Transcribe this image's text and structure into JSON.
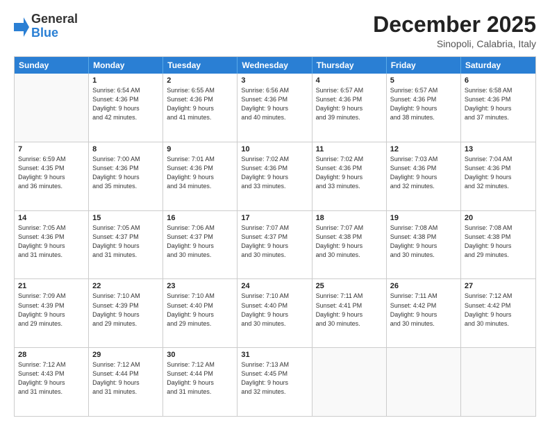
{
  "logo": {
    "general": "General",
    "blue": "Blue"
  },
  "header": {
    "month": "December 2025",
    "location": "Sinopoli, Calabria, Italy"
  },
  "days": [
    "Sunday",
    "Monday",
    "Tuesday",
    "Wednesday",
    "Thursday",
    "Friday",
    "Saturday"
  ],
  "rows": [
    [
      {
        "day": "",
        "lines": []
      },
      {
        "day": "1",
        "lines": [
          "Sunrise: 6:54 AM",
          "Sunset: 4:36 PM",
          "Daylight: 9 hours",
          "and 42 minutes."
        ]
      },
      {
        "day": "2",
        "lines": [
          "Sunrise: 6:55 AM",
          "Sunset: 4:36 PM",
          "Daylight: 9 hours",
          "and 41 minutes."
        ]
      },
      {
        "day": "3",
        "lines": [
          "Sunrise: 6:56 AM",
          "Sunset: 4:36 PM",
          "Daylight: 9 hours",
          "and 40 minutes."
        ]
      },
      {
        "day": "4",
        "lines": [
          "Sunrise: 6:57 AM",
          "Sunset: 4:36 PM",
          "Daylight: 9 hours",
          "and 39 minutes."
        ]
      },
      {
        "day": "5",
        "lines": [
          "Sunrise: 6:57 AM",
          "Sunset: 4:36 PM",
          "Daylight: 9 hours",
          "and 38 minutes."
        ]
      },
      {
        "day": "6",
        "lines": [
          "Sunrise: 6:58 AM",
          "Sunset: 4:36 PM",
          "Daylight: 9 hours",
          "and 37 minutes."
        ]
      }
    ],
    [
      {
        "day": "7",
        "lines": [
          "Sunrise: 6:59 AM",
          "Sunset: 4:35 PM",
          "Daylight: 9 hours",
          "and 36 minutes."
        ]
      },
      {
        "day": "8",
        "lines": [
          "Sunrise: 7:00 AM",
          "Sunset: 4:36 PM",
          "Daylight: 9 hours",
          "and 35 minutes."
        ]
      },
      {
        "day": "9",
        "lines": [
          "Sunrise: 7:01 AM",
          "Sunset: 4:36 PM",
          "Daylight: 9 hours",
          "and 34 minutes."
        ]
      },
      {
        "day": "10",
        "lines": [
          "Sunrise: 7:02 AM",
          "Sunset: 4:36 PM",
          "Daylight: 9 hours",
          "and 33 minutes."
        ]
      },
      {
        "day": "11",
        "lines": [
          "Sunrise: 7:02 AM",
          "Sunset: 4:36 PM",
          "Daylight: 9 hours",
          "and 33 minutes."
        ]
      },
      {
        "day": "12",
        "lines": [
          "Sunrise: 7:03 AM",
          "Sunset: 4:36 PM",
          "Daylight: 9 hours",
          "and 32 minutes."
        ]
      },
      {
        "day": "13",
        "lines": [
          "Sunrise: 7:04 AM",
          "Sunset: 4:36 PM",
          "Daylight: 9 hours",
          "and 32 minutes."
        ]
      }
    ],
    [
      {
        "day": "14",
        "lines": [
          "Sunrise: 7:05 AM",
          "Sunset: 4:36 PM",
          "Daylight: 9 hours",
          "and 31 minutes."
        ]
      },
      {
        "day": "15",
        "lines": [
          "Sunrise: 7:05 AM",
          "Sunset: 4:37 PM",
          "Daylight: 9 hours",
          "and 31 minutes."
        ]
      },
      {
        "day": "16",
        "lines": [
          "Sunrise: 7:06 AM",
          "Sunset: 4:37 PM",
          "Daylight: 9 hours",
          "and 30 minutes."
        ]
      },
      {
        "day": "17",
        "lines": [
          "Sunrise: 7:07 AM",
          "Sunset: 4:37 PM",
          "Daylight: 9 hours",
          "and 30 minutes."
        ]
      },
      {
        "day": "18",
        "lines": [
          "Sunrise: 7:07 AM",
          "Sunset: 4:38 PM",
          "Daylight: 9 hours",
          "and 30 minutes."
        ]
      },
      {
        "day": "19",
        "lines": [
          "Sunrise: 7:08 AM",
          "Sunset: 4:38 PM",
          "Daylight: 9 hours",
          "and 30 minutes."
        ]
      },
      {
        "day": "20",
        "lines": [
          "Sunrise: 7:08 AM",
          "Sunset: 4:38 PM",
          "Daylight: 9 hours",
          "and 29 minutes."
        ]
      }
    ],
    [
      {
        "day": "21",
        "lines": [
          "Sunrise: 7:09 AM",
          "Sunset: 4:39 PM",
          "Daylight: 9 hours",
          "and 29 minutes."
        ]
      },
      {
        "day": "22",
        "lines": [
          "Sunrise: 7:10 AM",
          "Sunset: 4:39 PM",
          "Daylight: 9 hours",
          "and 29 minutes."
        ]
      },
      {
        "day": "23",
        "lines": [
          "Sunrise: 7:10 AM",
          "Sunset: 4:40 PM",
          "Daylight: 9 hours",
          "and 29 minutes."
        ]
      },
      {
        "day": "24",
        "lines": [
          "Sunrise: 7:10 AM",
          "Sunset: 4:40 PM",
          "Daylight: 9 hours",
          "and 30 minutes."
        ]
      },
      {
        "day": "25",
        "lines": [
          "Sunrise: 7:11 AM",
          "Sunset: 4:41 PM",
          "Daylight: 9 hours",
          "and 30 minutes."
        ]
      },
      {
        "day": "26",
        "lines": [
          "Sunrise: 7:11 AM",
          "Sunset: 4:42 PM",
          "Daylight: 9 hours",
          "and 30 minutes."
        ]
      },
      {
        "day": "27",
        "lines": [
          "Sunrise: 7:12 AM",
          "Sunset: 4:42 PM",
          "Daylight: 9 hours",
          "and 30 minutes."
        ]
      }
    ],
    [
      {
        "day": "28",
        "lines": [
          "Sunrise: 7:12 AM",
          "Sunset: 4:43 PM",
          "Daylight: 9 hours",
          "and 31 minutes."
        ]
      },
      {
        "day": "29",
        "lines": [
          "Sunrise: 7:12 AM",
          "Sunset: 4:44 PM",
          "Daylight: 9 hours",
          "and 31 minutes."
        ]
      },
      {
        "day": "30",
        "lines": [
          "Sunrise: 7:12 AM",
          "Sunset: 4:44 PM",
          "Daylight: 9 hours",
          "and 31 minutes."
        ]
      },
      {
        "day": "31",
        "lines": [
          "Sunrise: 7:13 AM",
          "Sunset: 4:45 PM",
          "Daylight: 9 hours",
          "and 32 minutes."
        ]
      },
      {
        "day": "",
        "lines": []
      },
      {
        "day": "",
        "lines": []
      },
      {
        "day": "",
        "lines": []
      }
    ]
  ]
}
